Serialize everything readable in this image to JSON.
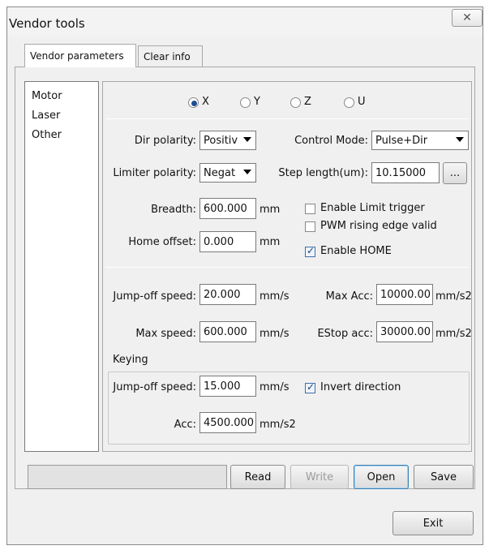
{
  "window": {
    "title": "Vendor tools",
    "close_glyph": "✕"
  },
  "tabs": [
    {
      "label": "Vendor parameters",
      "active": true
    },
    {
      "label": "Clear info",
      "active": false
    }
  ],
  "nav": {
    "items": [
      "Motor",
      "Laser",
      "Other"
    ]
  },
  "axis": {
    "options": [
      {
        "label": "X",
        "selected": true
      },
      {
        "label": "Y",
        "selected": false
      },
      {
        "label": "Z",
        "selected": false
      },
      {
        "label": "U",
        "selected": false
      }
    ]
  },
  "motor": {
    "dir_polarity": {
      "label": "Dir polarity:",
      "value": "Positiv"
    },
    "control_mode": {
      "label": "Control Mode:",
      "value": "Pulse+Dir"
    },
    "limiter_polarity": {
      "label": "Limiter polarity:",
      "value": "Negat"
    },
    "step_length": {
      "label": "Step length(um):",
      "value": "10.15000",
      "browse": "..."
    },
    "breadth": {
      "label": "Breadth:",
      "value": "600.000",
      "unit": "mm"
    },
    "home_offset": {
      "label": "Home offset:",
      "value": "0.000",
      "unit": "mm"
    },
    "checks": [
      {
        "label": "Enable Limit trigger",
        "checked": false
      },
      {
        "label": "PWM rising edge valid",
        "checked": false
      },
      {
        "label": "Enable HOME",
        "checked": true
      }
    ]
  },
  "speed": {
    "jump_off": {
      "label": "Jump-off speed:",
      "value": "20.000",
      "unit": "mm/s"
    },
    "max_acc": {
      "label": "Max Acc:",
      "value": "10000.00",
      "unit": "mm/s2"
    },
    "max_speed": {
      "label": "Max speed:",
      "value": "600.000",
      "unit": "mm/s"
    },
    "estop_acc": {
      "label": "EStop acc:",
      "value": "30000.00",
      "unit": "mm/s2"
    }
  },
  "keying": {
    "title": "Keying",
    "jump_off": {
      "label": "Jump-off speed:",
      "value": "15.000",
      "unit": "mm/s"
    },
    "invert": {
      "label": "Invert direction",
      "checked": true
    },
    "acc": {
      "label": "Acc:",
      "value": "4500.000",
      "unit": "mm/s2"
    }
  },
  "actions": {
    "read": "Read",
    "write": "Write",
    "open": "Open",
    "save": "Save",
    "exit": "Exit"
  }
}
